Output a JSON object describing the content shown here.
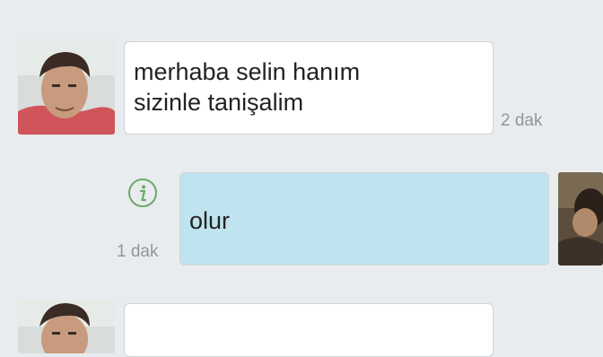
{
  "messages": [
    {
      "direction": "incoming",
      "text": "merhaba selin hanım\nsizinle tanişalim",
      "time": "2 dak"
    },
    {
      "direction": "outgoing",
      "text": "olur",
      "time": "1 dak",
      "status_icon": "info-icon"
    },
    {
      "direction": "incoming",
      "text": "",
      "time": ""
    }
  ],
  "colors": {
    "background": "#e9ecee",
    "incoming_bubble": "#ffffff",
    "outgoing_bubble": "#bfe3ef",
    "timestamp": "#8e979c",
    "info_icon": "#6aa86a"
  }
}
